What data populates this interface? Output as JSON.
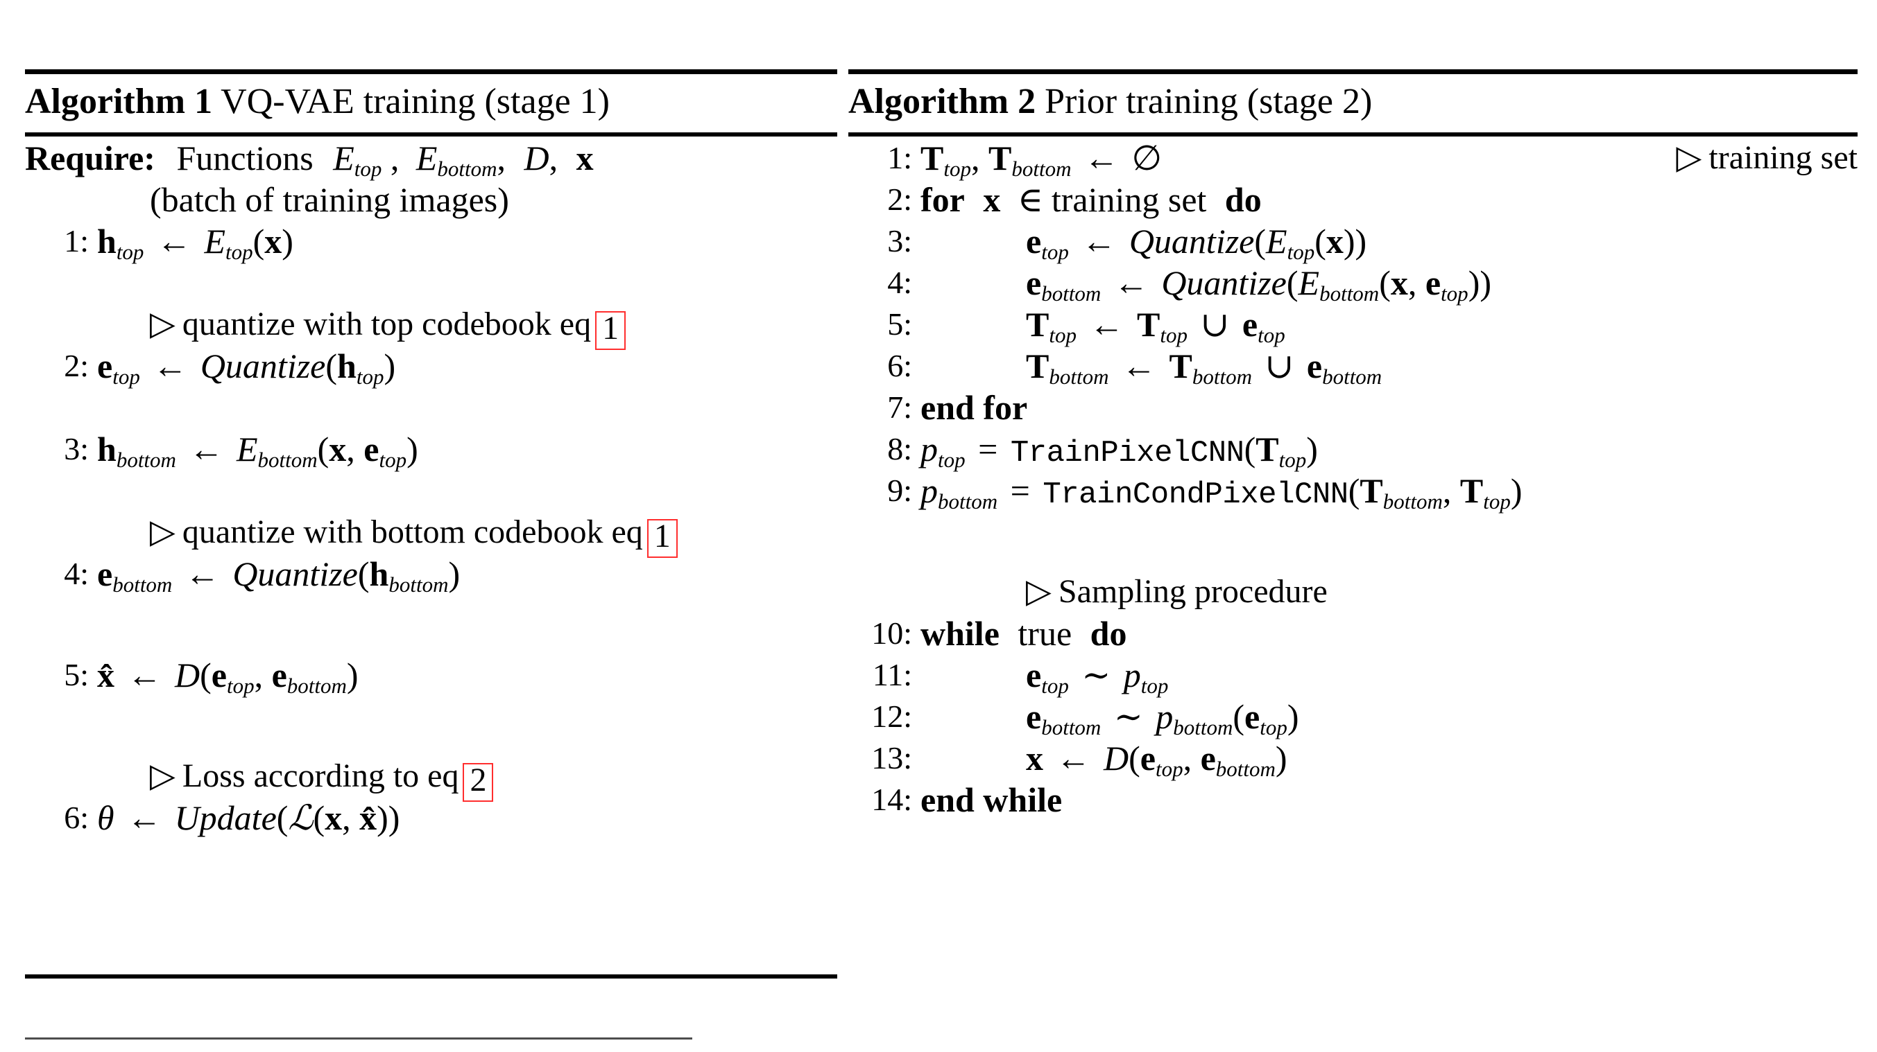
{
  "algorithms": [
    {
      "id": "algorithm-1",
      "label": "Algorithm 1",
      "caption": "VQ-VAE training (stage 1)",
      "require_label": "Require:",
      "require_text": "Functions",
      "require_args": "E_top , E_bottom, D, x",
      "require_cont": "(batch of training images)",
      "lines": [
        {
          "num": "1:",
          "text": "h_top ← E_top(x)"
        },
        {
          "comment": "quantize with top codebook eq",
          "eqref": "1"
        },
        {
          "num": "2:",
          "text": "e_top ← Quantize(h_top)"
        },
        {
          "num": "3:",
          "text": "h_bottom ← E_bottom(x, e_top)"
        },
        {
          "comment": "quantize with bottom codebook eq",
          "eqref": "1"
        },
        {
          "num": "4:",
          "text": "e_bottom ← Quantize(h_bottom)"
        },
        {
          "num": "5:",
          "text": "x̂ ← D(e_top, e_bottom)"
        },
        {
          "comment": "Loss according to eq",
          "eqref": "2"
        },
        {
          "num": "6:",
          "text": "θ ← Update(L(x, x̂))"
        }
      ]
    },
    {
      "id": "algorithm-2",
      "label": "Algorithm 2",
      "caption": "Prior training (stage 2)",
      "lines": [
        {
          "num": "1:",
          "text": "T_top, T_bottom ← ∅",
          "trailing_comment": "training set"
        },
        {
          "num": "2:",
          "text": "for x ∈ training set do"
        },
        {
          "num": "3:",
          "text": "e_top ← Quantize(E_top(x))"
        },
        {
          "num": "4:",
          "text": "e_bottom ← Quantize(E_bottom(x, e_top))"
        },
        {
          "num": "5:",
          "text": "T_top ← T_top ∪ e_top"
        },
        {
          "num": "6:",
          "text": "T_bottom ← T_bottom ∪ e_bottom"
        },
        {
          "num": "7:",
          "text": "end for"
        },
        {
          "num": "8:",
          "text": "p_top = TrainPixelCNN(T_top)"
        },
        {
          "num": "9:",
          "text": "p_bottom = TrainCondPixelCNN(T_bottom, T_top)"
        },
        {
          "comment": "Sampling procedure"
        },
        {
          "num": "10:",
          "text": "while true do"
        },
        {
          "num": "11:",
          "text": "e_top ~ p_top"
        },
        {
          "num": "12:",
          "text": "e_bottom ~ p_bottom(e_top)"
        },
        {
          "num": "13:",
          "text": "x ← D(e_top, e_bottom)"
        },
        {
          "num": "14:",
          "text": "end while"
        }
      ]
    }
  ],
  "symbols": {
    "triangle": "▹",
    "leftarrow": "←",
    "emptyset": "∅",
    "elementof": "∈",
    "union": "∪",
    "tilde": "∼",
    "theta": "θ",
    "hat_x": "x̂",
    "script_L": "ℒ"
  },
  "colors": {
    "text": "#000000",
    "rule": "#000000",
    "eqref_box": "#ff2e2e",
    "footnote_rule": "#4d4d4d",
    "background": "#ffffff"
  },
  "labels": {
    "keyword_for": "for",
    "keyword_do": "do",
    "keyword_end_for": "end for",
    "keyword_while": "while",
    "keyword_true": "true",
    "keyword_end_while": "end while",
    "training_set": "training set",
    "quantize": "Quantize",
    "update": "Update",
    "trainpixelcnn": "TrainPixelCNN",
    "traincondpixelcnn": "TrainCondPixelCNN",
    "functions": "Functions",
    "batch_note": "(batch of training images)",
    "comment_quantize_top": "quantize with top codebook eq",
    "comment_quantize_bottom": "quantize with bottom codebook eq",
    "comment_loss": "Loss according to eq",
    "comment_sampling": "Sampling procedure",
    "comment_training_set": "training set",
    "eq1": "1",
    "eq2": "2"
  }
}
